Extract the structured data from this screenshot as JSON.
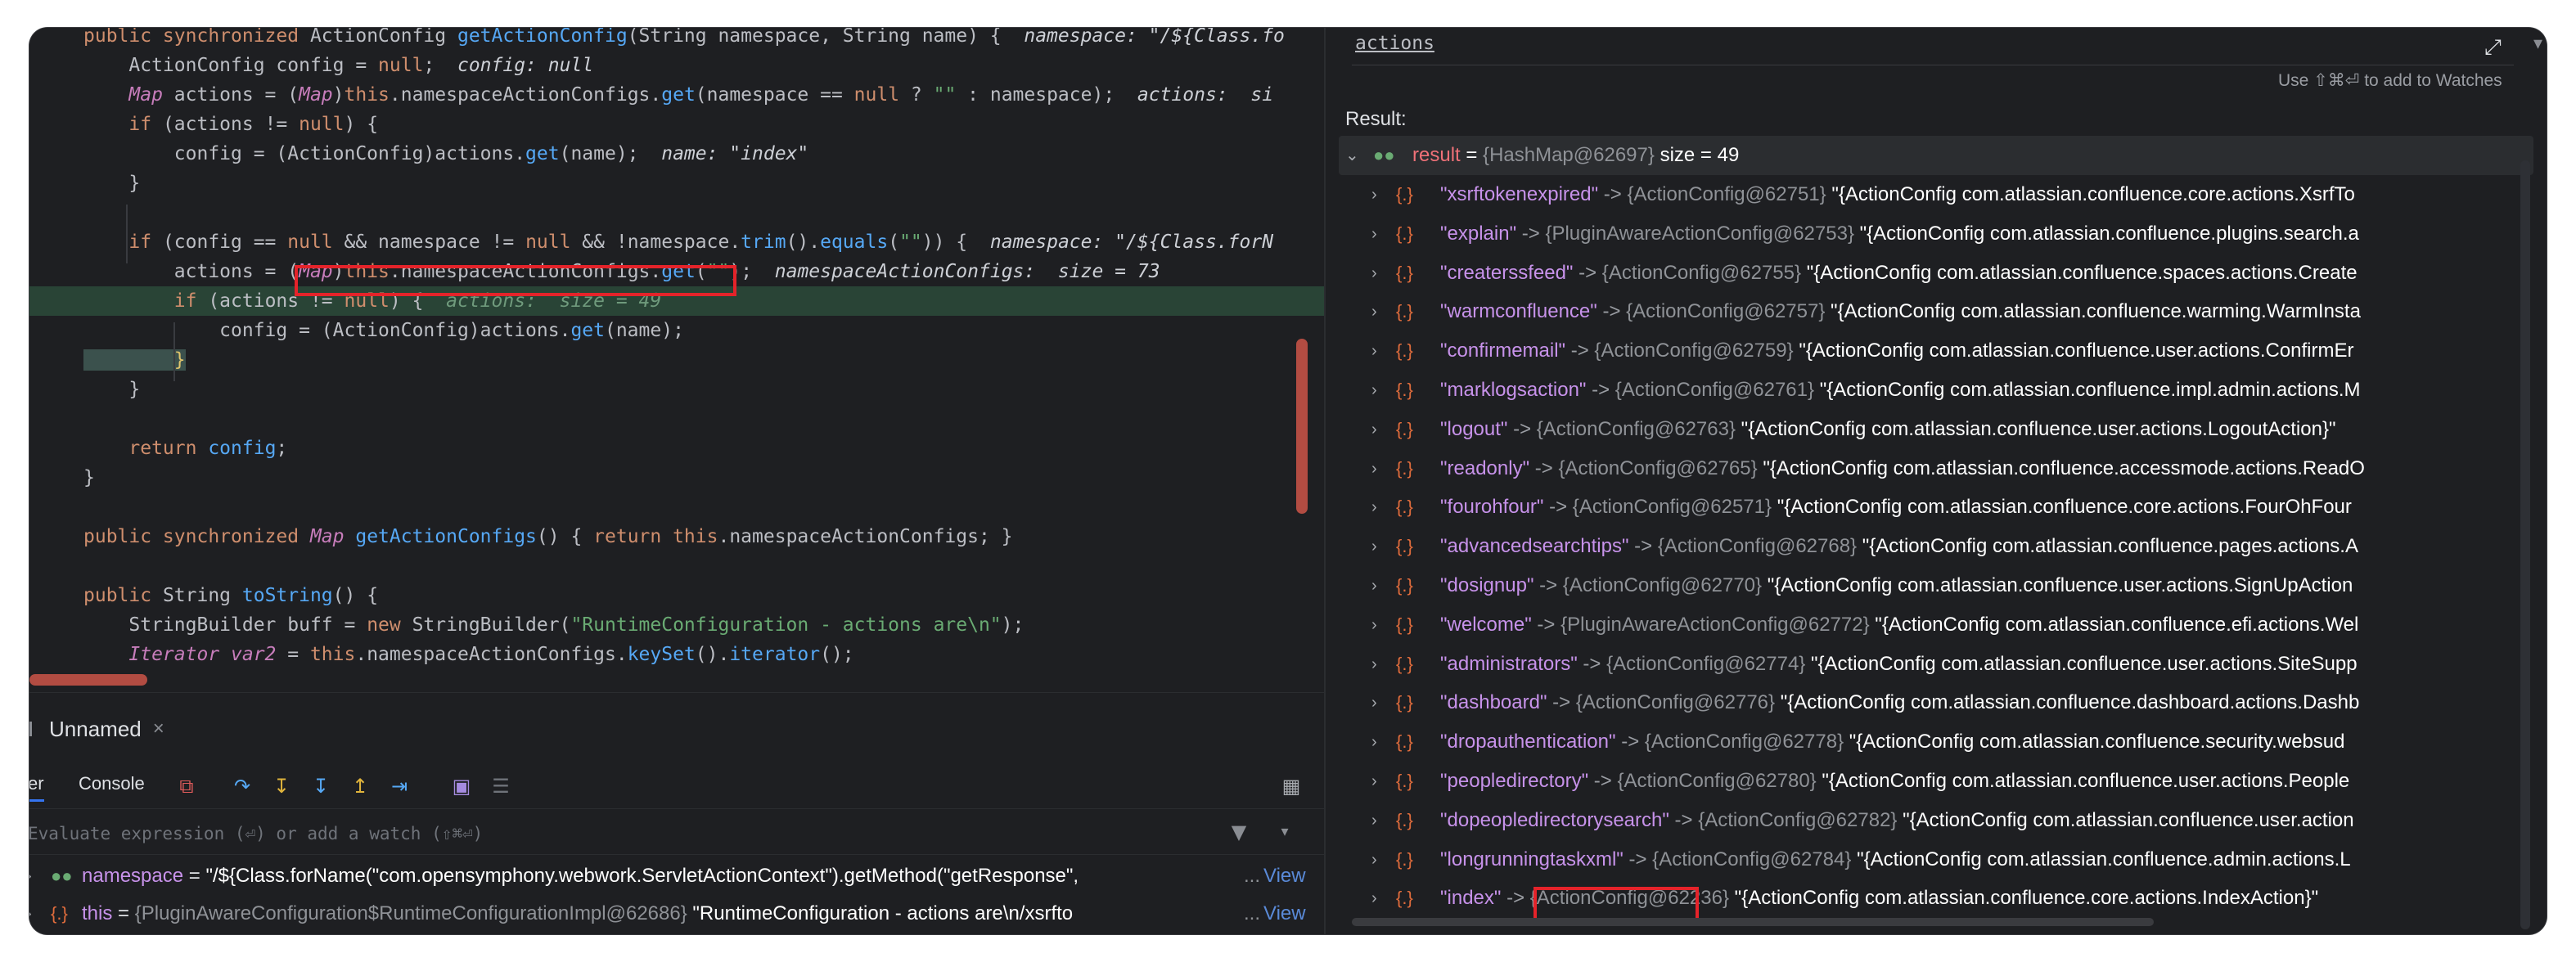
{
  "editor": {
    "lines": [
      [
        [
          "kw",
          "public synchronized "
        ],
        [
          "pl",
          "ActionConfig "
        ],
        [
          "fn",
          "getActionConfig"
        ],
        [
          "pl",
          "(String namespace, String name) {  "
        ],
        [
          "hint",
          "namespace: \"/${Class.fo"
        ]
      ],
      [
        [
          "pl",
          "    ActionConfig config = "
        ],
        [
          "kw",
          "null"
        ],
        [
          "pl",
          ";  "
        ],
        [
          "hint",
          "config: null"
        ]
      ],
      [
        [
          "ty",
          "    Map "
        ],
        [
          "pl",
          "actions = ("
        ],
        [
          "ty",
          "Map"
        ],
        [
          "pl",
          ")"
        ],
        [
          "kw",
          "this"
        ],
        [
          "pl",
          ".namespaceActionConfigs."
        ],
        [
          "fn",
          "get"
        ],
        [
          "pl",
          "(namespace == "
        ],
        [
          "kw",
          "null"
        ],
        [
          "pl",
          " ? "
        ],
        [
          "st",
          "\"\""
        ],
        [
          "pl",
          " : namespace);  "
        ],
        [
          "hint",
          "actions:  si"
        ]
      ],
      [
        [
          "kw",
          "    if "
        ],
        [
          "pl",
          "(actions != "
        ],
        [
          "kw",
          "null"
        ],
        [
          "pl",
          ") {"
        ]
      ],
      [
        [
          "pl",
          "        config = (ActionConfig)actions."
        ],
        [
          "fn",
          "get"
        ],
        [
          "pl",
          "(name);  "
        ],
        [
          "hint",
          "name: \"index\""
        ]
      ],
      [
        [
          "pl",
          "    }"
        ]
      ],
      [
        [
          "pl",
          ""
        ]
      ],
      [
        [
          "kw",
          "    if "
        ],
        [
          "pl",
          "(config == "
        ],
        [
          "kw",
          "null"
        ],
        [
          "pl",
          " && namespace != "
        ],
        [
          "kw",
          "null"
        ],
        [
          "pl",
          " && !namespace."
        ],
        [
          "fn",
          "trim"
        ],
        [
          "pl",
          "()."
        ],
        [
          "fn",
          "equals"
        ],
        [
          "pl",
          "("
        ],
        [
          "st",
          "\"\""
        ],
        [
          "pl",
          ")) {  "
        ],
        [
          "hint",
          "namespace: \"/${Class.forN"
        ]
      ],
      [
        [
          "pl",
          "        actions = ("
        ],
        [
          "ty",
          "Map"
        ],
        [
          "pl",
          ")"
        ],
        [
          "kw",
          "this"
        ],
        [
          "pl",
          ".namespaceActionConfigs."
        ],
        [
          "fn",
          "get"
        ],
        [
          "pl",
          "("
        ],
        [
          "st",
          "\"\""
        ],
        [
          "pl",
          ");  "
        ],
        [
          "hint",
          "namespaceActionConfigs:  size = 73"
        ]
      ],
      [
        [
          "kw",
          "        if "
        ],
        [
          "pl",
          "(actions != "
        ],
        [
          "kw",
          "null"
        ],
        [
          "pl",
          ") {  "
        ],
        [
          "hintdim",
          "actions:  size = 49"
        ]
      ],
      [
        [
          "pl",
          "            config = (ActionConfig)actions."
        ],
        [
          "fn",
          "get"
        ],
        [
          "pl",
          "(name);"
        ]
      ],
      [
        [
          "br",
          "        }"
        ]
      ],
      [
        [
          "pl",
          "    }"
        ]
      ],
      [
        [
          "pl",
          ""
        ]
      ],
      [
        [
          "kw",
          "    return "
        ],
        [
          "fn",
          "config"
        ],
        [
          "pl",
          ";"
        ]
      ],
      [
        [
          "pl",
          "}"
        ]
      ],
      [
        [
          "pl",
          ""
        ]
      ],
      [
        [
          "kw",
          "public synchronized "
        ],
        [
          "ty",
          "Map "
        ],
        [
          "fn",
          "getActionConfigs"
        ],
        [
          "pl",
          "() { "
        ],
        [
          "kw",
          "return this"
        ],
        [
          "pl",
          ".namespaceActionConfigs; }"
        ]
      ],
      [
        [
          "pl",
          ""
        ]
      ],
      [
        [
          "kw",
          "public "
        ],
        [
          "pl",
          "String "
        ],
        [
          "fn",
          "toString"
        ],
        [
          "pl",
          "() {"
        ]
      ],
      [
        [
          "pl",
          "    StringBuilder buff = "
        ],
        [
          "kw",
          "new "
        ],
        [
          "pl",
          "StringBuilder("
        ],
        [
          "st",
          "\"RuntimeConfiguration - actions are\\n\""
        ],
        [
          "pl",
          ");"
        ]
      ],
      [
        [
          "ty",
          "    Iterator var2 "
        ],
        [
          "pl",
          "= "
        ],
        [
          "kw",
          "this"
        ],
        [
          "pl",
          ".namespaceActionConfigs."
        ],
        [
          "fn",
          "keySet"
        ],
        [
          "pl",
          "()."
        ],
        [
          "fn",
          "iterator"
        ],
        [
          "pl",
          "();"
        ]
      ]
    ]
  },
  "debugger": {
    "tab_name": "Unnamed",
    "toolbar_left_label": "er",
    "console_label": "Console",
    "eval_placeholder": "Evaluate expression (⏎) or add a watch (⇧⌘⏎)",
    "variables": [
      {
        "name": "namespace",
        "eq": " = ",
        "value": "\"/${Class.forName(\"com.opensymphony.webwork.ServletActionContext\").getMethod(\"getResponse\",",
        "ellipsis": "...",
        "view": "View"
      },
      {
        "name": "this",
        "eq": " = ",
        "ref": "{PluginAwareConfiguration$RuntimeConfigurationImpl@62686} ",
        "value": "\"RuntimeConfiguration - actions are\\n/xsrfto",
        "ellipsis": "...",
        "view": "View"
      }
    ]
  },
  "evaluate": {
    "expression": "actions",
    "hint": "Use ⇧⌘⏎ to add to Watches",
    "result_label": "Result:",
    "root": {
      "name": "result",
      "eq": " = ",
      "ref": "{HashMap@62697}",
      "size": "  size = 49"
    },
    "entries": [
      {
        "key": "\"xsrftokenexpired\"",
        "ref": "{ActionConfig@62751}",
        "value": "\"{ActionConfig com.atlassian.confluence.core.actions.XsrfTo"
      },
      {
        "key": "\"explain\"",
        "ref": "{PluginAwareActionConfig@62753}",
        "value": "\"{ActionConfig com.atlassian.confluence.plugins.search.a"
      },
      {
        "key": "\"createrssfeed\"",
        "ref": "{ActionConfig@62755}",
        "value": "\"{ActionConfig com.atlassian.confluence.spaces.actions.Create"
      },
      {
        "key": "\"warmconfluence\"",
        "ref": "{ActionConfig@62757}",
        "value": "\"{ActionConfig com.atlassian.confluence.warming.WarmInsta"
      },
      {
        "key": "\"confirmemail\"",
        "ref": "{ActionConfig@62759}",
        "value": "\"{ActionConfig com.atlassian.confluence.user.actions.ConfirmEr"
      },
      {
        "key": "\"marklogsaction\"",
        "ref": "{ActionConfig@62761}",
        "value": "\"{ActionConfig com.atlassian.confluence.impl.admin.actions.M"
      },
      {
        "key": "\"logout\"",
        "ref": "{ActionConfig@62763}",
        "value": "\"{ActionConfig com.atlassian.confluence.user.actions.LogoutAction}\""
      },
      {
        "key": "\"readonly\"",
        "ref": "{ActionConfig@62765}",
        "value": "\"{ActionConfig com.atlassian.confluence.accessmode.actions.ReadO"
      },
      {
        "key": "\"fourohfour\"",
        "ref": "{ActionConfig@62571}",
        "value": "\"{ActionConfig com.atlassian.confluence.core.actions.FourOhFour"
      },
      {
        "key": "\"advancedsearchtips\"",
        "ref": "{ActionConfig@62768}",
        "value": "\"{ActionConfig com.atlassian.confluence.pages.actions.A"
      },
      {
        "key": "\"dosignup\"",
        "ref": "{ActionConfig@62770}",
        "value": "\"{ActionConfig com.atlassian.confluence.user.actions.SignUpAction"
      },
      {
        "key": "\"welcome\"",
        "ref": "{PluginAwareActionConfig@62772}",
        "value": "\"{ActionConfig com.atlassian.confluence.efi.actions.Wel"
      },
      {
        "key": "\"administrators\"",
        "ref": "{ActionConfig@62774}",
        "value": "\"{ActionConfig com.atlassian.confluence.user.actions.SiteSupp"
      },
      {
        "key": "\"dashboard\"",
        "ref": "{ActionConfig@62776}",
        "value": "\"{ActionConfig com.atlassian.confluence.dashboard.actions.Dashb"
      },
      {
        "key": "\"dropauthentication\"",
        "ref": "{ActionConfig@62778}",
        "value": "\"{ActionConfig com.atlassian.confluence.security.websud"
      },
      {
        "key": "\"peopledirectory\"",
        "ref": "{ActionConfig@62780}",
        "value": "\"{ActionConfig com.atlassian.confluence.user.actions.People"
      },
      {
        "key": "\"dopeopledirectorysearch\"",
        "ref": "{ActionConfig@62782}",
        "value": "\"{ActionConfig com.atlassian.confluence.user.action"
      },
      {
        "key": "\"longrunningtaskxml\"",
        "ref": "{ActionConfig@62784}",
        "value": "\"{ActionConfig com.atlassian.confluence.admin.actions.L"
      },
      {
        "key": "\"index\"",
        "ref": "{ActionConfig@62236}",
        "value": "\"{ActionConfig com.atlassian.confluence.core.actions.IndexAction}\""
      }
    ]
  },
  "colors": {
    "highlight_box": "#e5232a",
    "execution_line": "#294436",
    "background": "#1e1f22"
  }
}
